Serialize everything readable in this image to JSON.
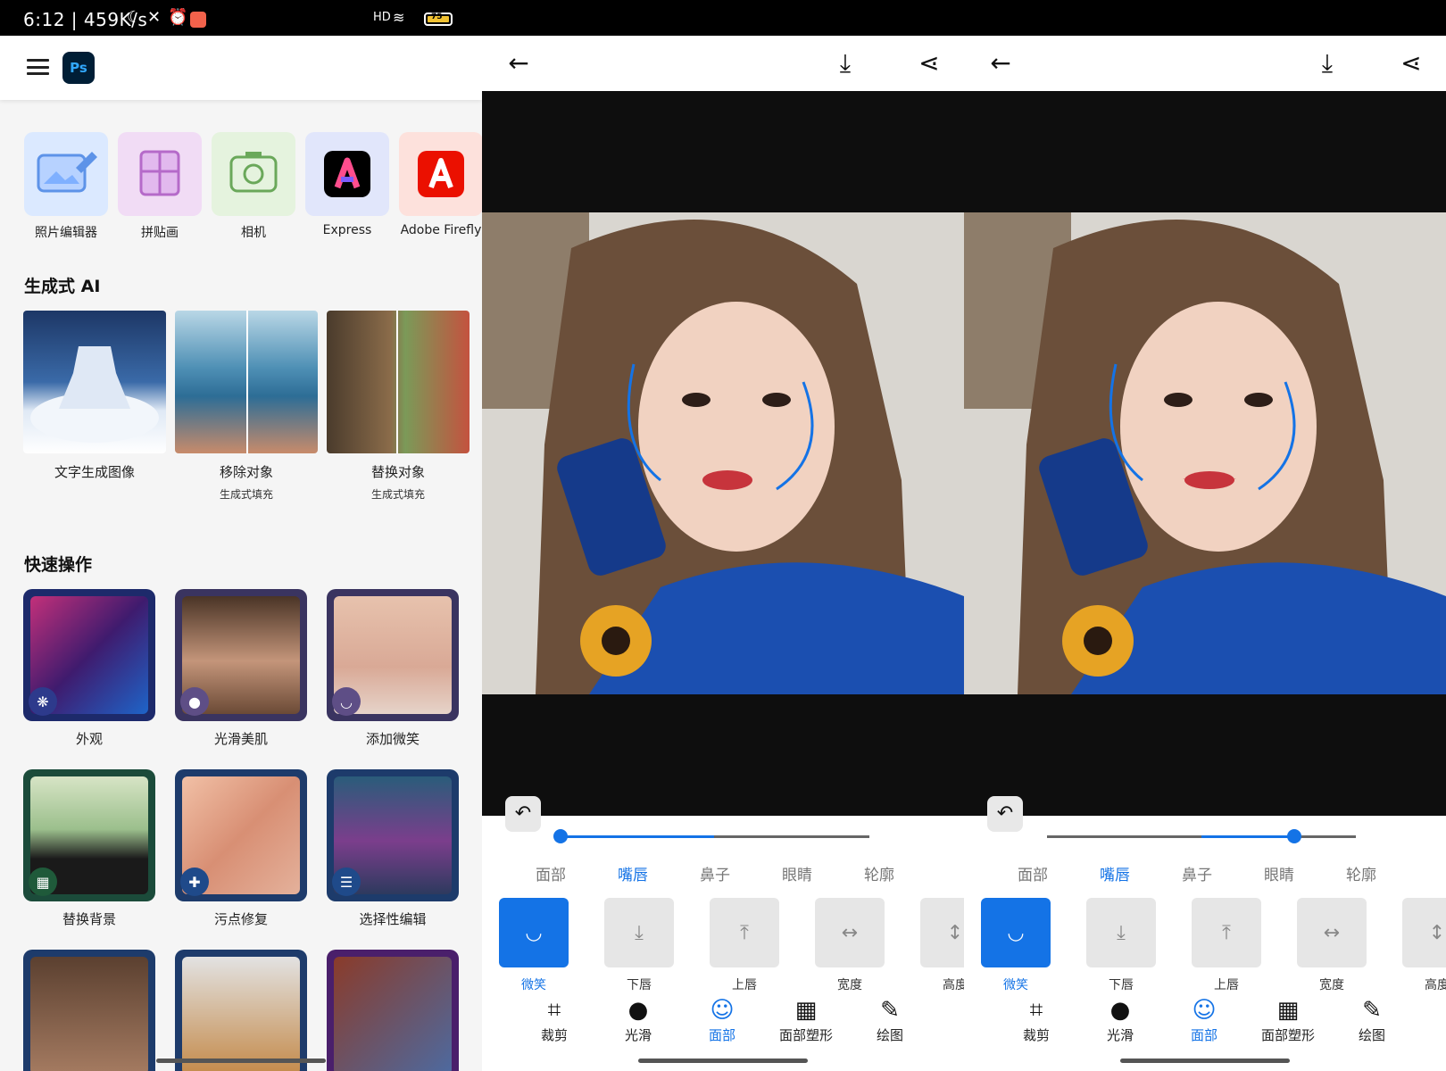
{
  "status": {
    "time": "6:12 | 459K/s",
    "network": "HD",
    "battery": "75"
  },
  "home": {
    "apps": [
      {
        "label": "照片编辑器",
        "icon": "photo-editor-icon",
        "bg": "#dbe9ff"
      },
      {
        "label": "拼贴画",
        "icon": "collage-icon",
        "bg": "#f1dcf5"
      },
      {
        "label": "相机",
        "icon": "camera-icon",
        "bg": "#e5f3de"
      },
      {
        "label": "Express",
        "icon": "express-logo",
        "bg": "#e1e6fb"
      },
      {
        "label": "Adobe Firefly",
        "icon": "firefly-logo",
        "bg": "#fde1dc"
      }
    ],
    "gen_ai_title": "生成式 AI",
    "gen_ai": [
      {
        "title": "文字生成图像",
        "sub": ""
      },
      {
        "title": "移除对象",
        "sub": "生成式填充"
      },
      {
        "title": "替换对象",
        "sub": "生成式填充"
      }
    ],
    "quick_title": "快速操作",
    "quick": [
      {
        "label": "外观",
        "icon": "looks-icon",
        "badge": "#2d3a8c"
      },
      {
        "label": "光滑美肌",
        "icon": "smooth-skin-icon",
        "badge": "#5e4e86"
      },
      {
        "label": "添加微笑",
        "icon": "smile-icon",
        "badge": "#5e4e86"
      },
      {
        "label": "替换背景",
        "icon": "background-icon",
        "badge": "#1f5a3a"
      },
      {
        "label": "污点修复",
        "icon": "bandage-icon",
        "badge": "#1f4a8a"
      },
      {
        "label": "选择性编辑",
        "icon": "sliders-icon",
        "badge": "#1f4a8a"
      }
    ]
  },
  "editor": {
    "tabs": [
      "面部",
      "嘴唇",
      "鼻子",
      "眼睛",
      "轮廓"
    ],
    "active_tab": "嘴唇",
    "tools": [
      "微笑",
      "下唇",
      "上唇",
      "宽度",
      "高度"
    ],
    "nav": [
      "裁剪",
      "光滑",
      "面部",
      "面部塑形",
      "绘图"
    ],
    "panel1_slider": 0.0,
    "panel2_slider": 0.8
  },
  "colors": {
    "accent": "#1473e6"
  }
}
